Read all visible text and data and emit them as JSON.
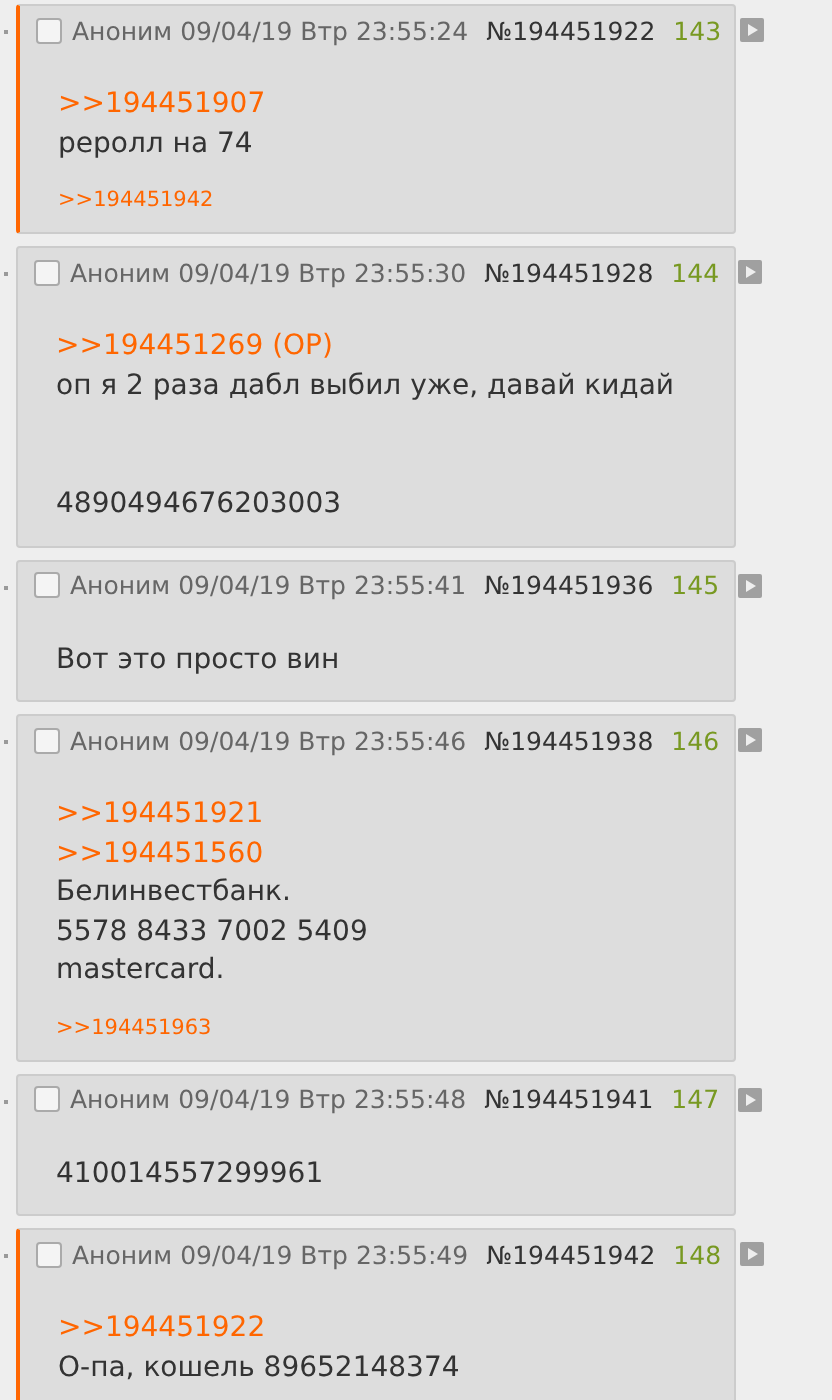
{
  "posts": [
    {
      "highlighted": true,
      "checked": false,
      "author": "Аноним",
      "date": "09/04/19 Втр 23:55:24",
      "number": "№194451922",
      "index": "143",
      "lines": [
        {
          "kind": "link",
          "text": ">>194451907"
        },
        {
          "kind": "text",
          "text": "реролл на 74"
        }
      ],
      "replies": [
        ">>194451942"
      ]
    },
    {
      "highlighted": false,
      "checked": false,
      "author": "Аноним",
      "date": "09/04/19 Втр 23:55:30",
      "number": "№194451928",
      "index": "144",
      "lines": [
        {
          "kind": "link",
          "text": ">>194451269 (OP)"
        },
        {
          "kind": "text",
          "text": "оп я 2 раза дабл выбил уже, давай кидай"
        },
        {
          "kind": "break"
        },
        {
          "kind": "break"
        },
        {
          "kind": "text",
          "text": "4890494676203003"
        }
      ]
    },
    {
      "highlighted": false,
      "checked": false,
      "author": "Аноним",
      "date": "09/04/19 Втр 23:55:41",
      "number": "№194451936",
      "index": "145",
      "lines": [
        {
          "kind": "text",
          "text": "Вот это просто вин"
        }
      ]
    },
    {
      "highlighted": false,
      "checked": false,
      "author": "Аноним",
      "date": "09/04/19 Втр 23:55:46",
      "number": "№194451938",
      "index": "146",
      "lines": [
        {
          "kind": "link",
          "text": ">>194451921"
        },
        {
          "kind": "link",
          "text": ">>194451560"
        },
        {
          "kind": "text",
          "text": "Белинвестбанк."
        },
        {
          "kind": "text",
          "text": "5578 8433 7002 5409"
        },
        {
          "kind": "text",
          "text": "mastercard."
        }
      ],
      "replies": [
        ">>194451963"
      ]
    },
    {
      "highlighted": false,
      "checked": false,
      "author": "Аноним",
      "date": "09/04/19 Втр 23:55:48",
      "number": "№194451941",
      "index": "147",
      "lines": [
        {
          "kind": "text",
          "text": "410014557299961"
        }
      ]
    },
    {
      "highlighted": true,
      "checked": false,
      "author": "Аноним",
      "date": "09/04/19 Втр 23:55:49",
      "number": "№194451942",
      "index": "148",
      "lines": [
        {
          "kind": "link",
          "text": ">>194451922"
        },
        {
          "kind": "text",
          "text": "О-па, кошель 89652148374"
        }
      ]
    }
  ]
}
